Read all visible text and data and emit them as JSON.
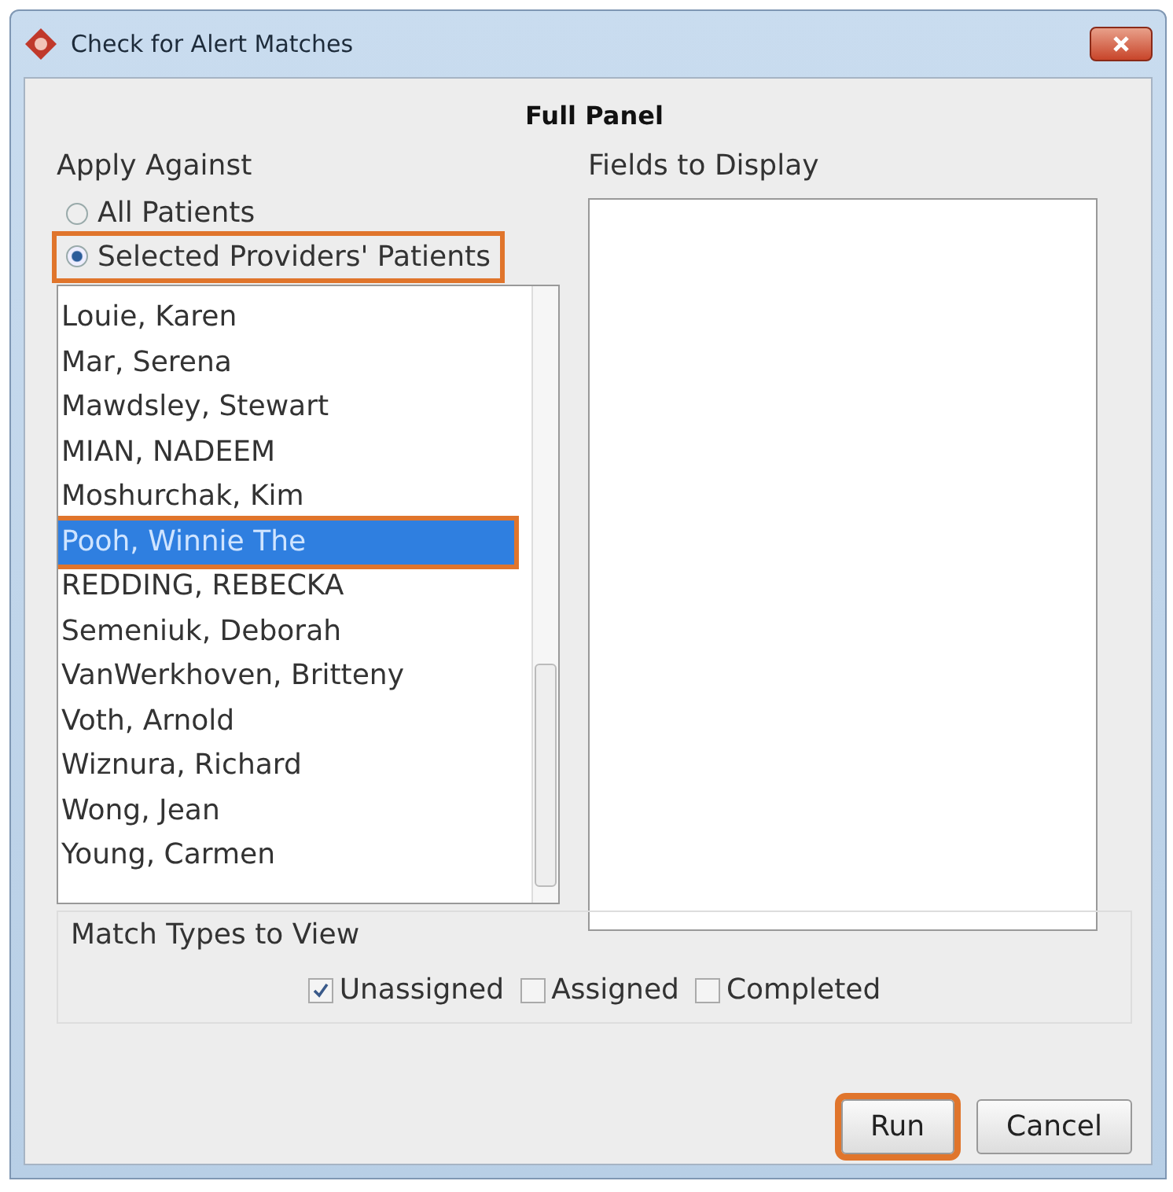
{
  "window": {
    "title": "Check for Alert Matches"
  },
  "heading": "Full Panel",
  "apply_against": {
    "label": "Apply Against",
    "options": [
      {
        "label": "All Patients",
        "selected": false,
        "highlighted": false
      },
      {
        "label": "Selected Providers' Patients",
        "selected": true,
        "highlighted": true
      }
    ]
  },
  "providers": [
    {
      "name": "Louie, Karen",
      "selected": false,
      "highlighted": false
    },
    {
      "name": "Mar, Serena",
      "selected": false,
      "highlighted": false
    },
    {
      "name": "Mawdsley, Stewart",
      "selected": false,
      "highlighted": false
    },
    {
      "name": "MIAN, NADEEM",
      "selected": false,
      "highlighted": false
    },
    {
      "name": "Moshurchak, Kim",
      "selected": false,
      "highlighted": false
    },
    {
      "name": "Pooh, Winnie The",
      "selected": true,
      "highlighted": true
    },
    {
      "name": "REDDING, REBECKA",
      "selected": false,
      "highlighted": false
    },
    {
      "name": "Semeniuk, Deborah",
      "selected": false,
      "highlighted": false
    },
    {
      "name": "VanWerkhoven, Britteny",
      "selected": false,
      "highlighted": false
    },
    {
      "name": "Voth, Arnold",
      "selected": false,
      "highlighted": false
    },
    {
      "name": "Wiznura, Richard",
      "selected": false,
      "highlighted": false
    },
    {
      "name": "Wong, Jean",
      "selected": false,
      "highlighted": false
    },
    {
      "name": "Young, Carmen",
      "selected": false,
      "highlighted": false
    }
  ],
  "fields_to_display": {
    "label": "Fields to Display"
  },
  "match_types": {
    "label": "Match Types to View",
    "options": [
      {
        "label": "Unassigned",
        "checked": true
      },
      {
        "label": "Assigned",
        "checked": false
      },
      {
        "label": "Completed",
        "checked": false
      }
    ]
  },
  "buttons": [
    {
      "label": "Run",
      "highlighted": true
    },
    {
      "label": "Cancel",
      "highlighted": false
    }
  ]
}
